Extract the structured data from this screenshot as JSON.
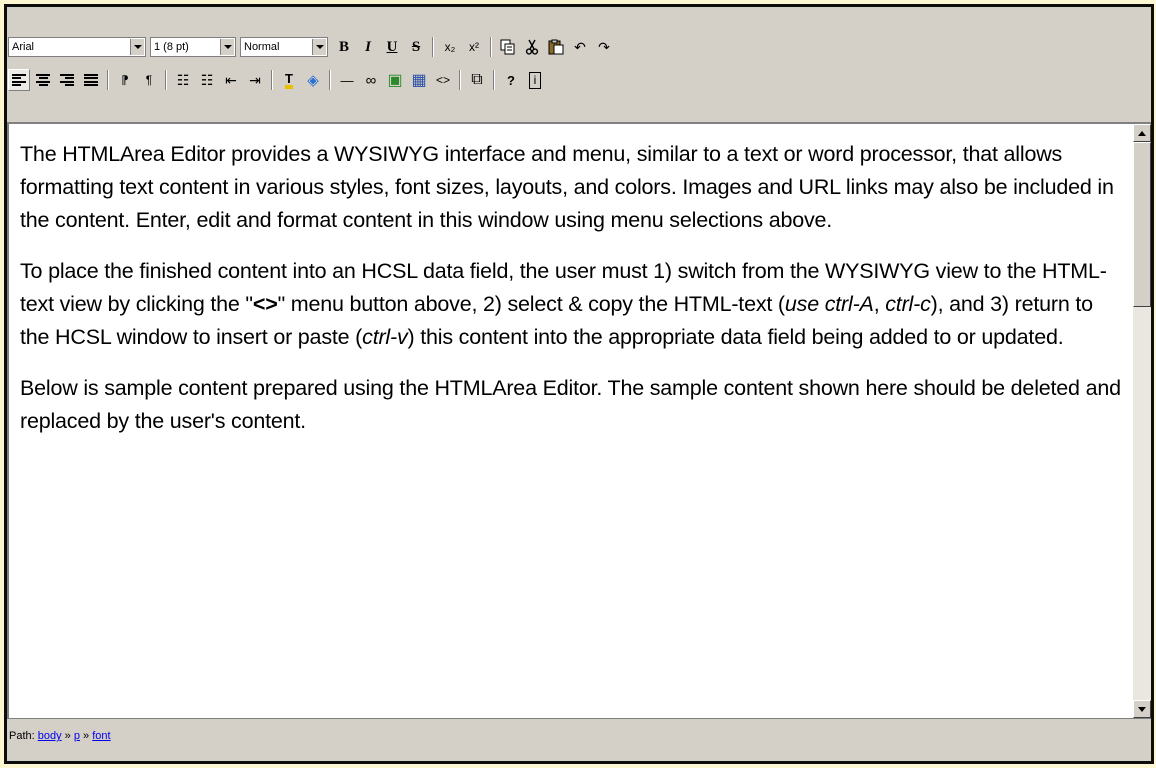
{
  "toolbar": {
    "font_name": "Arial",
    "font_size": "1 (8 pt)",
    "block_format": "Normal",
    "bold": "B",
    "italic": "I",
    "underline": "U",
    "strikethrough": "S",
    "subscript": "x₂",
    "superscript": "x²",
    "undo": "↶",
    "redo": "↷",
    "ltr": "⁋",
    "rtl": "¶",
    "ordered_list": "☷",
    "unordered_list": "☷",
    "outdent": "⇤",
    "indent": "⇥",
    "text_color": "T",
    "bg_color": "◈",
    "hr": "—",
    "link": "∞",
    "image": "▣",
    "table": "▦",
    "html_mode": "<>",
    "fullscreen": "⧉",
    "help": "?",
    "about": "i"
  },
  "content": {
    "p1": "The HTMLArea Editor provides a WYSIWYG interface and menu, similar to a text or word processor, that allows formatting text content in various styles, font sizes, layouts, and colors. Images and URL links may also be included in the content. Enter, edit and format content in this window using menu selections above.",
    "p2_part1": "To place the finished content into an HCSL data field, the user must 1) switch from the WYSIWYG view to the HTML-text view by clicking the \"",
    "p2_bold": "<>",
    "p2_part2": "\" menu button above, 2) select & copy the HTML-text (",
    "p2_italic1": "use ctrl-A",
    "p2_part3": ", ",
    "p2_italic2": "ctrl-c",
    "p2_part4": "), and 3) return to the HCSL window to insert or paste (",
    "p2_italic3": "ctrl-v",
    "p2_part5": ") this content into the appropriate data field being added to or updated.",
    "p3": "Below is sample content prepared using the HTMLArea Editor. The sample content shown here should be deleted and replaced by the user's content."
  },
  "status": {
    "label": "Path:",
    "crumb1": "body",
    "sep": "»",
    "crumb2": "p",
    "crumb3": "font"
  },
  "colors": {
    "outer_background": "#fdf7d2",
    "chrome": "#d4d0c8",
    "link": "#0000ee"
  }
}
